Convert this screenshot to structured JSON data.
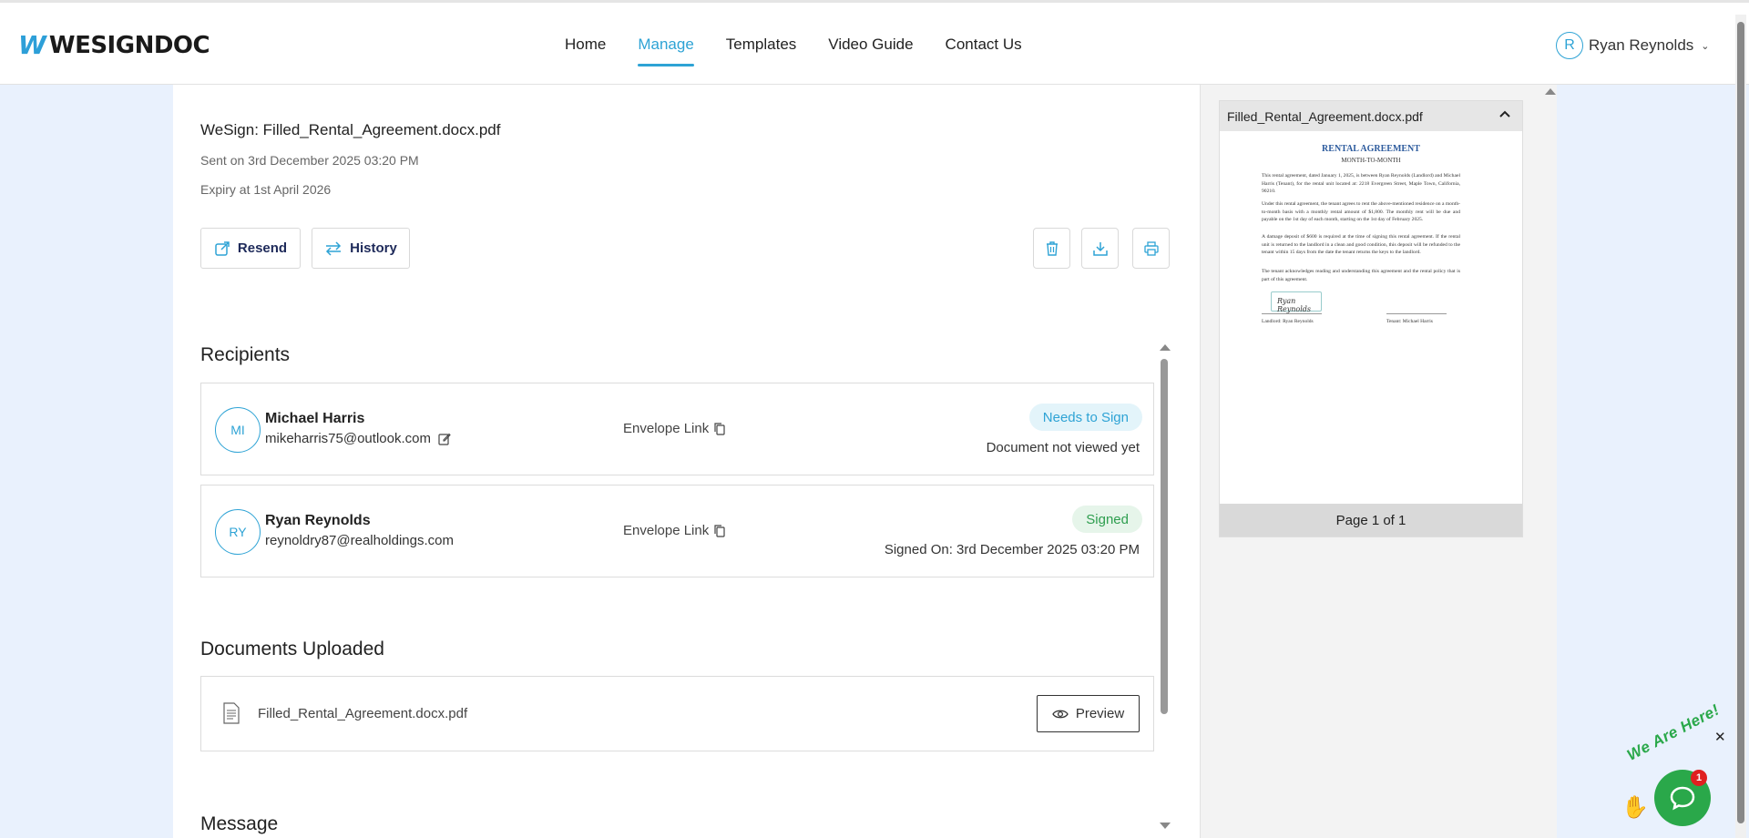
{
  "brand": {
    "mark": "W",
    "name": "WESIGNDOC"
  },
  "nav": {
    "items": [
      {
        "label": "Home",
        "active": false
      },
      {
        "label": "Manage",
        "active": true
      },
      {
        "label": "Templates",
        "active": false
      },
      {
        "label": "Video Guide",
        "active": false
      },
      {
        "label": "Contact Us",
        "active": false
      }
    ]
  },
  "user": {
    "initial": "R",
    "name": "Ryan Reynolds"
  },
  "envelope": {
    "title": "WeSign: Filled_Rental_Agreement.docx.pdf",
    "sent": "Sent on 3rd December 2025 03:20 PM",
    "expiry": "Expiry at 1st April 2026"
  },
  "actions": {
    "resend": "Resend",
    "history": "History"
  },
  "recipients": {
    "heading": "Recipients",
    "envelope_link_label": "Envelope Link",
    "items": [
      {
        "initials": "MI",
        "name": "Michael Harris",
        "email": "mikeharris75@outlook.com",
        "badge": "Needs to Sign",
        "status": "Document not viewed yet"
      },
      {
        "initials": "RY",
        "name": "Ryan Reynolds",
        "email": "reynoldry87@realholdings.com",
        "badge": "Signed",
        "status": "Signed On: 3rd December 2025 03:20 PM"
      }
    ]
  },
  "documents": {
    "heading": "Documents Uploaded",
    "file_name": "Filled_Rental_Agreement.docx.pdf",
    "preview_label": "Preview"
  },
  "message": {
    "heading": "Message"
  },
  "preview_panel": {
    "file_name": "Filled_Rental_Agreement.docx.pdf",
    "page_label": "Page 1 of 1",
    "doc": {
      "title": "RENTAL AGREEMENT",
      "subtitle": "MONTH-TO-MONTH",
      "para1": "This rental agreement, dated January 1, 2025, is between Ryan Reynolds (Landlord) and Michael Harris (Tenant), for the rental unit located at: 2218 Evergreen Street, Maple Town, California, 90210.",
      "para2": "Under this rental agreement, the tenant agrees to rent the above-mentioned residence on a month-to-month basis with a monthly rental amount of $1,800. The monthly rent will be due and payable on the 1st day of each month, starting on the 1st day of February 2025.",
      "para3": "A damage deposit of $600 is required at the time of signing this rental agreement. If the rental unit is returned to the landlord in a clean and good condition, this deposit will be refunded to the tenant within 15 days from the date the tenant returns the keys to the landlord.",
      "para4": "The tenant acknowledges reading and understanding this agreement and the rental policy that is part of this agreement.",
      "landlord_label": "Landlord: Ryan Reynolds",
      "tenant_label": "Tenant: Michael Harris",
      "signature": "Ryan Reynolds"
    }
  },
  "chat": {
    "tagline": "We Are Here!",
    "badge_count": "1"
  },
  "colors": {
    "accent": "#2ea3d5",
    "signed": "#2e9e4f",
    "needs_sign": "#2ea3d5",
    "chat": "#2aa84a"
  }
}
